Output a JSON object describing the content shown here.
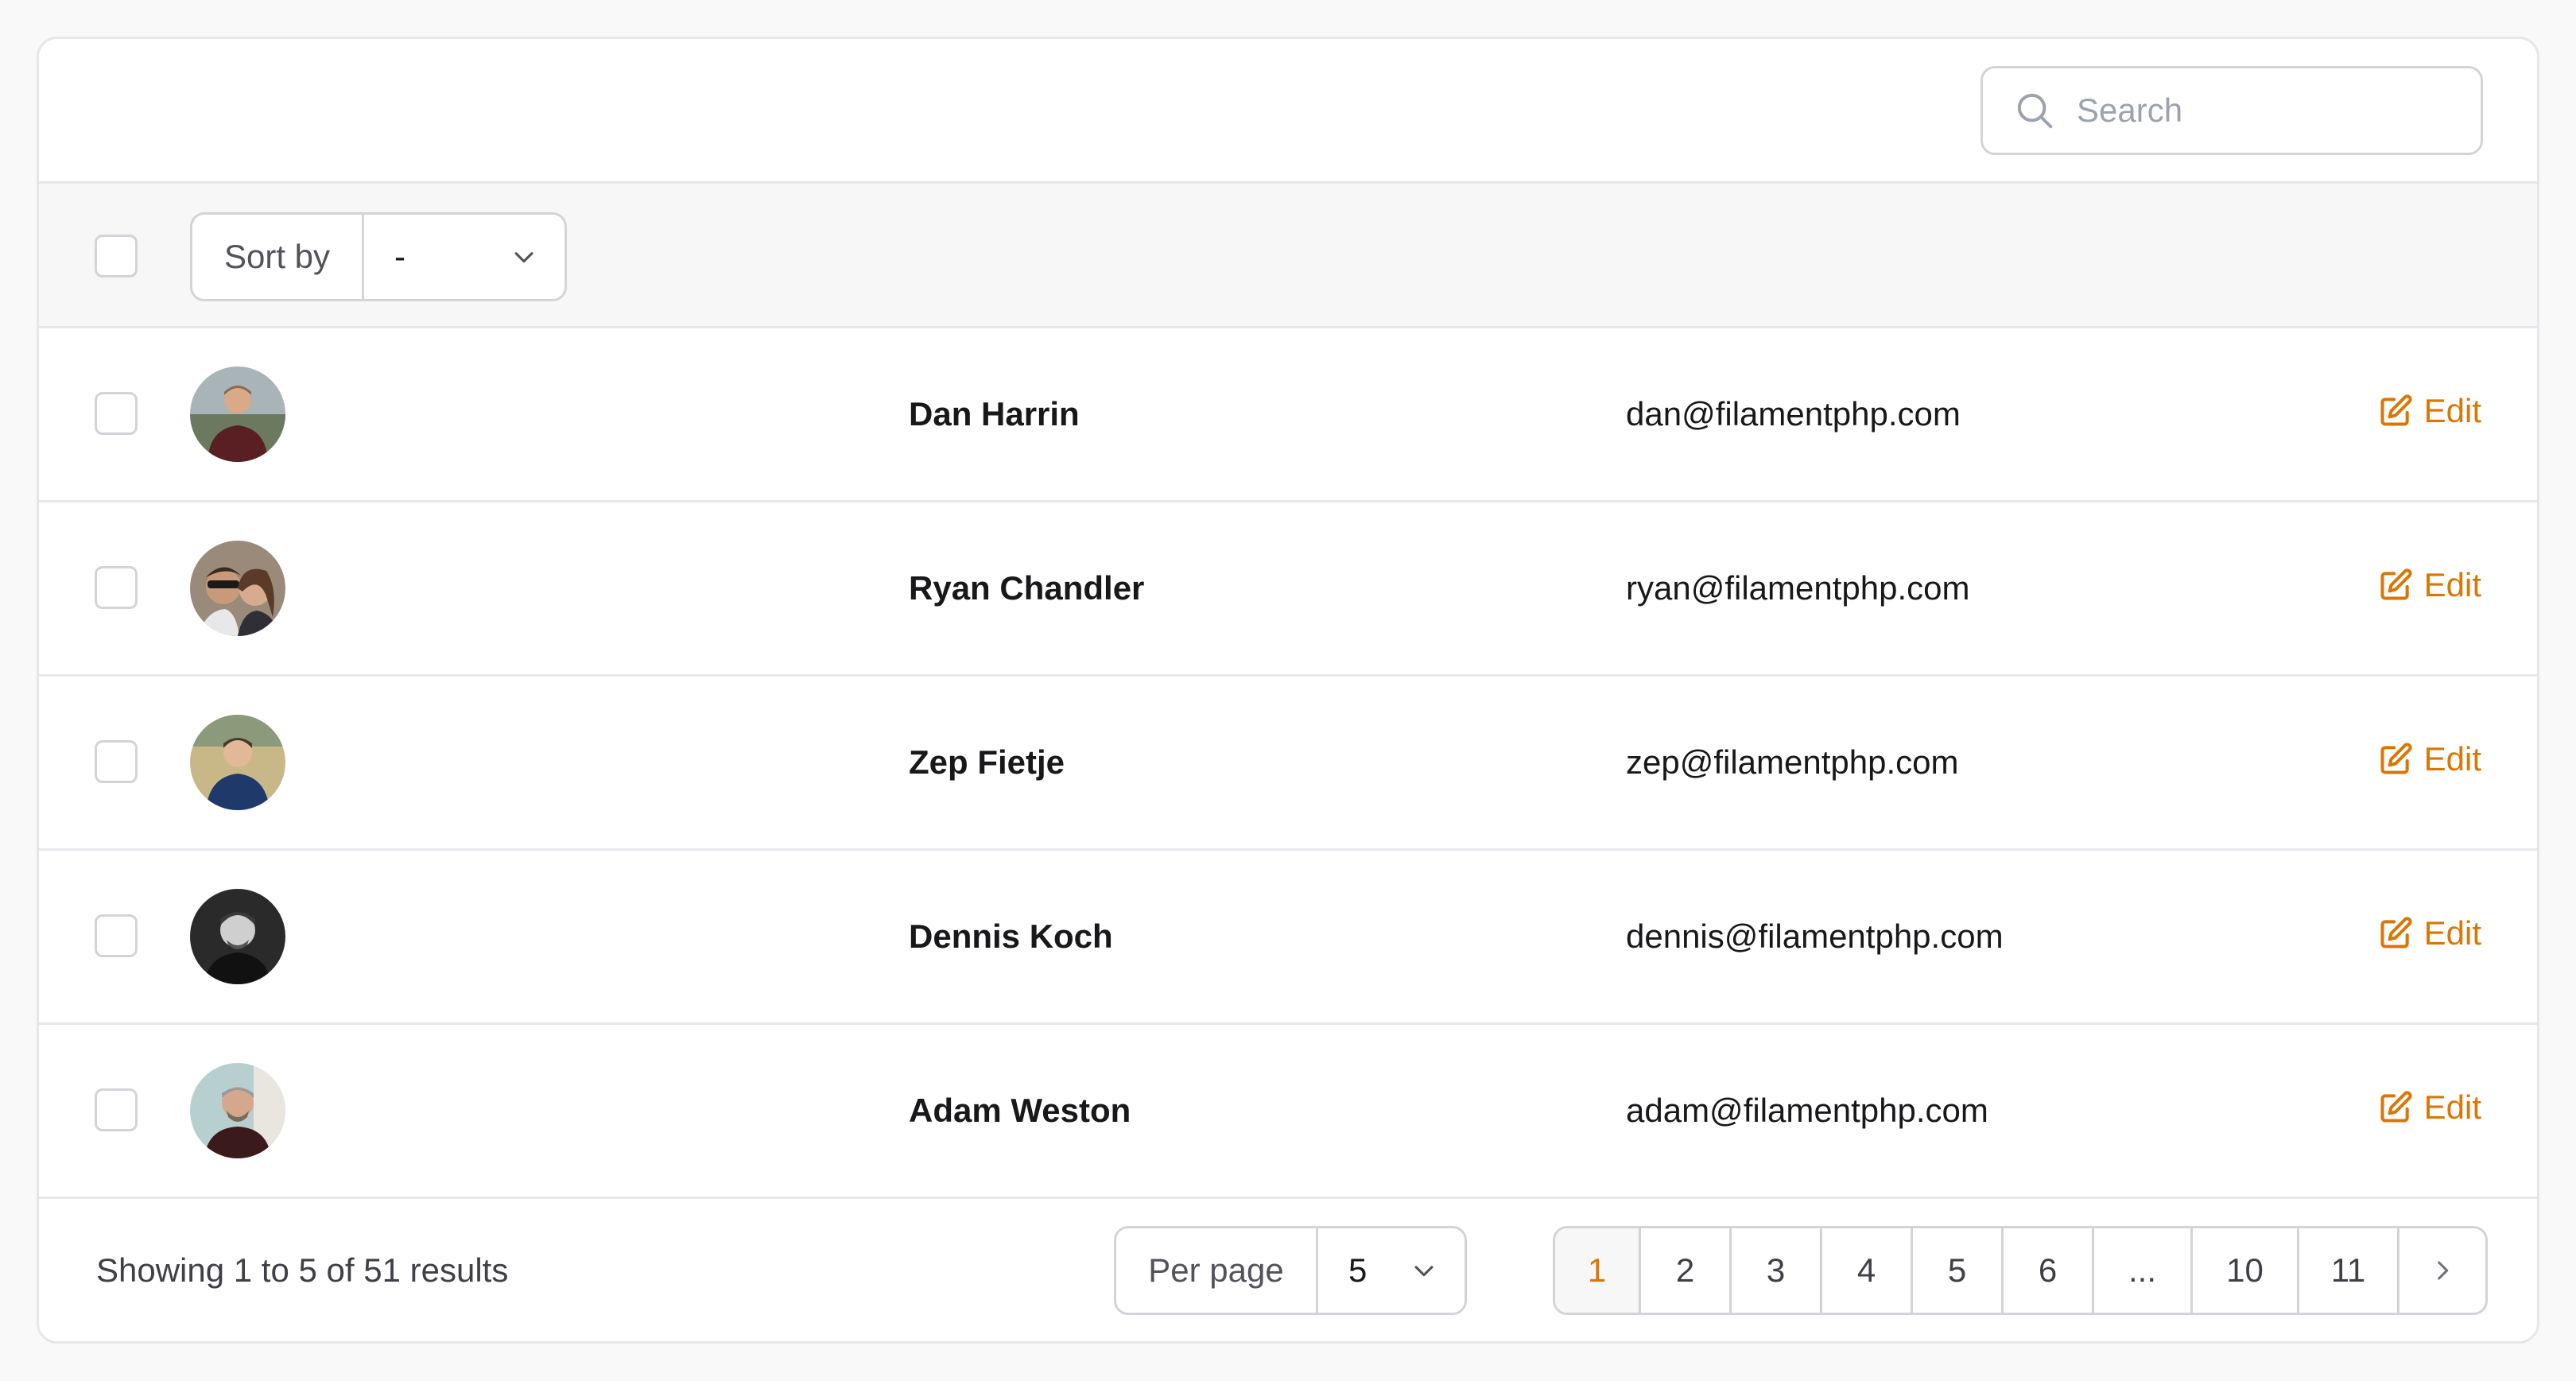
{
  "search": {
    "placeholder": "Search",
    "value": ""
  },
  "toolbar": {
    "sort_label": "Sort by",
    "sort_value": "-"
  },
  "rows": [
    {
      "name": "Dan Harrin",
      "email": "dan@filamentphp.com",
      "action": "Edit"
    },
    {
      "name": "Ryan Chandler",
      "email": "ryan@filamentphp.com",
      "action": "Edit"
    },
    {
      "name": "Zep Fietje",
      "email": "zep@filamentphp.com",
      "action": "Edit"
    },
    {
      "name": "Dennis Koch",
      "email": "dennis@filamentphp.com",
      "action": "Edit"
    },
    {
      "name": "Adam Weston",
      "email": "adam@filamentphp.com",
      "action": "Edit"
    }
  ],
  "footer": {
    "showing": "Showing 1 to 5 of 51 results",
    "per_page_label": "Per page",
    "per_page_value": "5",
    "pages": [
      "1",
      "2",
      "3",
      "4",
      "5",
      "6",
      "...",
      "10",
      "11"
    ],
    "current_page": "1"
  },
  "colors": {
    "accent": "#d97706",
    "border": "#e5e7eb",
    "toolbar_bg": "#f7f7f7"
  },
  "icons": {
    "search": "search-icon",
    "sort_chevron": "chevron-down-icon",
    "edit": "pencil-square-icon",
    "next": "chevron-right-icon"
  }
}
